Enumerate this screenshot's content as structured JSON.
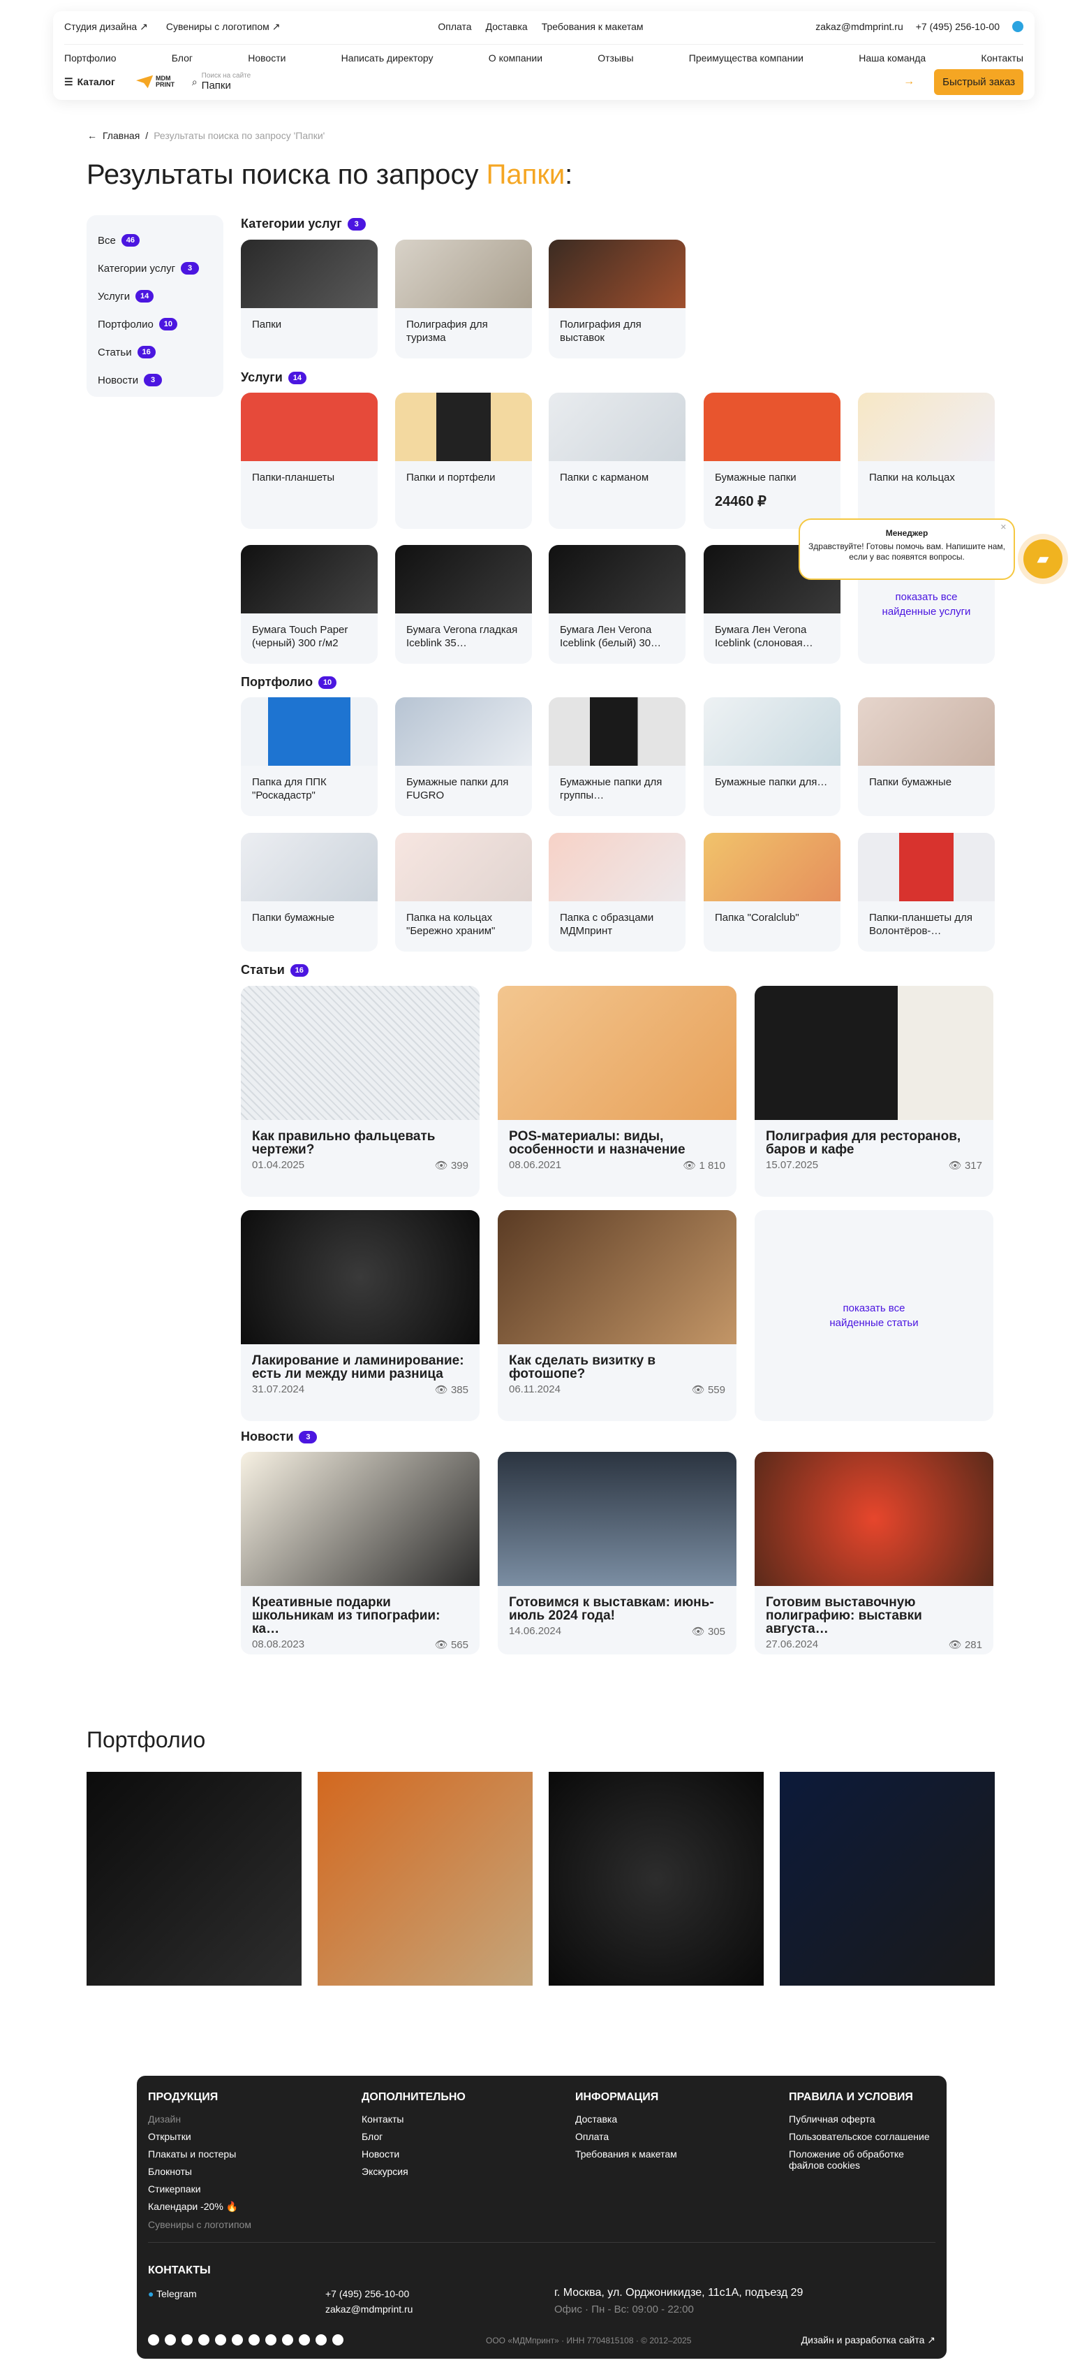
{
  "header": {
    "top_left": [
      "Студия дизайна ↗",
      "Сувениры с логотипом ↗"
    ],
    "top_mid": [
      "Оплата",
      "Доставка",
      "Требования к макетам"
    ],
    "email": "zakaz@mdmprint.ru",
    "phone": "+7 (495) 256-10-00",
    "nav": [
      "Портфолио",
      "Блог",
      "Новости",
      "Написать директору",
      "О компании",
      "Отзывы",
      "Преимущества компании",
      "Наша команда",
      "Контакты"
    ],
    "catalog": "Каталог",
    "logo_text": "MDM PRINT",
    "search_label": "Поиск на сайте",
    "search_value": "Папки",
    "fast_order": "Быстрый заказ"
  },
  "breadcrumb": {
    "home": "Главная",
    "sep": "/",
    "current": "Результаты поиска по запросу 'Папки'"
  },
  "title": {
    "prefix": "Результаты поиска по запросу",
    "query": "Папки",
    "suffix": ":"
  },
  "filters": [
    {
      "label": "Все",
      "count": "46"
    },
    {
      "label": "Категории услуг",
      "count": "3"
    },
    {
      "label": "Услуги",
      "count": "14"
    },
    {
      "label": "Портфолио",
      "count": "10"
    },
    {
      "label": "Статьи",
      "count": "16"
    },
    {
      "label": "Новости",
      "count": "3"
    }
  ],
  "sections": {
    "categories": {
      "title": "Категории услуг",
      "count": "3",
      "items": [
        "Папки",
        "Полиграфия для туризма",
        "Полиграфия для выставок"
      ]
    },
    "services": {
      "title": "Услуги",
      "count": "14",
      "items": [
        "Папки-планшеты",
        "Папки и портфели",
        "Папки с карманом",
        "Бумажные папки",
        "Папки на кольцах",
        "Бумага Touch Paper (черный) 300 г/м2",
        "Бумага Verona гладкая Iceblink 35…",
        "Бумага Лен Verona Iceblink (белый) 30…",
        "Бумага Лен Verona Iceblink (слоновая…"
      ],
      "price": "24460 ₽",
      "more": "показать все найденные услуги"
    },
    "portfolio": {
      "title": "Портфолио",
      "count": "10",
      "items": [
        "Папка для ППК \"Роскадастр\"",
        "Бумажные папки для FUGRO",
        "Бумажные папки для группы…",
        "Бумажные папки для…",
        "Папки бумажные",
        "Папки бумажные",
        "Папка на кольцах \"Бережно храним\"",
        "Папка с образцами МДМпринт",
        "Папка \"Coralclub\"",
        "Папки-планшеты для Волонтёров-…"
      ]
    },
    "articles": {
      "title": "Статьи",
      "count": "16",
      "items": [
        {
          "title": "Как правильно фальцевать чертежи?",
          "date": "01.04.2025",
          "views": "399"
        },
        {
          "title": "POS-материалы: виды, особенности и назначение",
          "date": "08.06.2021",
          "views": "1 810"
        },
        {
          "title": "Полиграфия для ресторанов, баров и кафе",
          "date": "15.07.2025",
          "views": "317"
        },
        {
          "title": "Лакирование и ламинирование: есть ли между ними разница",
          "date": "31.07.2024",
          "views": "385"
        },
        {
          "title": "Как сделать визитку в фотошопе?",
          "date": "06.11.2024",
          "views": "559"
        }
      ],
      "more": "показать все найденные статьи"
    },
    "news": {
      "title": "Новости",
      "count": "3",
      "items": [
        {
          "title": "Креативные подарки школьникам из типографии: ка…",
          "date": "08.08.2023",
          "views": "565"
        },
        {
          "title": "Готовимся к выставкам: июнь-июль 2024 года!",
          "date": "14.06.2024",
          "views": "305"
        },
        {
          "title": "Готовим выставочную полиграфию: выставки августа…",
          "date": "27.06.2024",
          "views": "281"
        }
      ]
    }
  },
  "chat": {
    "name": "Менеджер",
    "text": "Здравствуйте! Готовы помочь вам. Напишите нам, если у вас появятся вопросы."
  },
  "portfolio_block": {
    "title": "Портфолио"
  },
  "footer": {
    "cols": [
      {
        "title": "ПРОДУКЦИЯ",
        "items": [
          "Дизайн",
          "Открытки",
          "Плакаты и постеры",
          "Блокноты",
          "Стикерпаки",
          "Календари -20% 🔥",
          "Сувениры с логотипом"
        ]
      },
      {
        "title": "ДОПОЛНИТЕЛЬНО",
        "items": [
          "Контакты",
          "Блог",
          "Новости",
          "Экскурсия"
        ]
      },
      {
        "title": "ИНФОРМАЦИЯ",
        "items": [
          "Доставка",
          "Оплата",
          "Требования к макетам"
        ]
      },
      {
        "title": "ПРАВИЛА И УСЛОВИЯ",
        "items": [
          "Публичная оферта",
          "Пользовательское соглашение",
          "Положение об обработке файлов cookies"
        ]
      }
    ],
    "contacts_title": "КОНТАКТЫ",
    "telegram": "Telegram",
    "phone": "+7 (495) 256-10-00",
    "email": "zakaz@mdmprint.ru",
    "address": "г. Москва, ул. Орджоникидзе, 11с1А, подъезд 29",
    "hours": "Офис · Пн - Вс: 09:00 - 22:00",
    "legal": "ООО «МДМпринт» · ИНН 7704815108 · © 2012–2025",
    "dev": "Дизайн и разработка сайта ↗"
  }
}
